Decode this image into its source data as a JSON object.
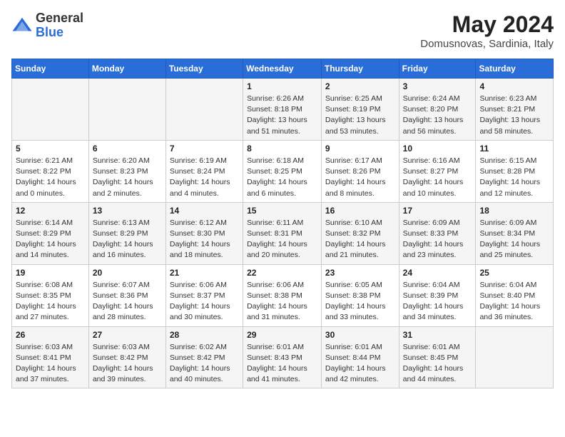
{
  "header": {
    "logo_general": "General",
    "logo_blue": "Blue",
    "title": "May 2024",
    "location": "Domusnovas, Sardinia, Italy"
  },
  "weekdays": [
    "Sunday",
    "Monday",
    "Tuesday",
    "Wednesday",
    "Thursday",
    "Friday",
    "Saturday"
  ],
  "weeks": [
    [
      {
        "day": "",
        "sunrise": "",
        "sunset": "",
        "daylight": ""
      },
      {
        "day": "",
        "sunrise": "",
        "sunset": "",
        "daylight": ""
      },
      {
        "day": "",
        "sunrise": "",
        "sunset": "",
        "daylight": ""
      },
      {
        "day": "1",
        "sunrise": "Sunrise: 6:26 AM",
        "sunset": "Sunset: 8:18 PM",
        "daylight": "Daylight: 13 hours and 51 minutes."
      },
      {
        "day": "2",
        "sunrise": "Sunrise: 6:25 AM",
        "sunset": "Sunset: 8:19 PM",
        "daylight": "Daylight: 13 hours and 53 minutes."
      },
      {
        "day": "3",
        "sunrise": "Sunrise: 6:24 AM",
        "sunset": "Sunset: 8:20 PM",
        "daylight": "Daylight: 13 hours and 56 minutes."
      },
      {
        "day": "4",
        "sunrise": "Sunrise: 6:23 AM",
        "sunset": "Sunset: 8:21 PM",
        "daylight": "Daylight: 13 hours and 58 minutes."
      }
    ],
    [
      {
        "day": "5",
        "sunrise": "Sunrise: 6:21 AM",
        "sunset": "Sunset: 8:22 PM",
        "daylight": "Daylight: 14 hours and 0 minutes."
      },
      {
        "day": "6",
        "sunrise": "Sunrise: 6:20 AM",
        "sunset": "Sunset: 8:23 PM",
        "daylight": "Daylight: 14 hours and 2 minutes."
      },
      {
        "day": "7",
        "sunrise": "Sunrise: 6:19 AM",
        "sunset": "Sunset: 8:24 PM",
        "daylight": "Daylight: 14 hours and 4 minutes."
      },
      {
        "day": "8",
        "sunrise": "Sunrise: 6:18 AM",
        "sunset": "Sunset: 8:25 PM",
        "daylight": "Daylight: 14 hours and 6 minutes."
      },
      {
        "day": "9",
        "sunrise": "Sunrise: 6:17 AM",
        "sunset": "Sunset: 8:26 PM",
        "daylight": "Daylight: 14 hours and 8 minutes."
      },
      {
        "day": "10",
        "sunrise": "Sunrise: 6:16 AM",
        "sunset": "Sunset: 8:27 PM",
        "daylight": "Daylight: 14 hours and 10 minutes."
      },
      {
        "day": "11",
        "sunrise": "Sunrise: 6:15 AM",
        "sunset": "Sunset: 8:28 PM",
        "daylight": "Daylight: 14 hours and 12 minutes."
      }
    ],
    [
      {
        "day": "12",
        "sunrise": "Sunrise: 6:14 AM",
        "sunset": "Sunset: 8:29 PM",
        "daylight": "Daylight: 14 hours and 14 minutes."
      },
      {
        "day": "13",
        "sunrise": "Sunrise: 6:13 AM",
        "sunset": "Sunset: 8:29 PM",
        "daylight": "Daylight: 14 hours and 16 minutes."
      },
      {
        "day": "14",
        "sunrise": "Sunrise: 6:12 AM",
        "sunset": "Sunset: 8:30 PM",
        "daylight": "Daylight: 14 hours and 18 minutes."
      },
      {
        "day": "15",
        "sunrise": "Sunrise: 6:11 AM",
        "sunset": "Sunset: 8:31 PM",
        "daylight": "Daylight: 14 hours and 20 minutes."
      },
      {
        "day": "16",
        "sunrise": "Sunrise: 6:10 AM",
        "sunset": "Sunset: 8:32 PM",
        "daylight": "Daylight: 14 hours and 21 minutes."
      },
      {
        "day": "17",
        "sunrise": "Sunrise: 6:09 AM",
        "sunset": "Sunset: 8:33 PM",
        "daylight": "Daylight: 14 hours and 23 minutes."
      },
      {
        "day": "18",
        "sunrise": "Sunrise: 6:09 AM",
        "sunset": "Sunset: 8:34 PM",
        "daylight": "Daylight: 14 hours and 25 minutes."
      }
    ],
    [
      {
        "day": "19",
        "sunrise": "Sunrise: 6:08 AM",
        "sunset": "Sunset: 8:35 PM",
        "daylight": "Daylight: 14 hours and 27 minutes."
      },
      {
        "day": "20",
        "sunrise": "Sunrise: 6:07 AM",
        "sunset": "Sunset: 8:36 PM",
        "daylight": "Daylight: 14 hours and 28 minutes."
      },
      {
        "day": "21",
        "sunrise": "Sunrise: 6:06 AM",
        "sunset": "Sunset: 8:37 PM",
        "daylight": "Daylight: 14 hours and 30 minutes."
      },
      {
        "day": "22",
        "sunrise": "Sunrise: 6:06 AM",
        "sunset": "Sunset: 8:38 PM",
        "daylight": "Daylight: 14 hours and 31 minutes."
      },
      {
        "day": "23",
        "sunrise": "Sunrise: 6:05 AM",
        "sunset": "Sunset: 8:38 PM",
        "daylight": "Daylight: 14 hours and 33 minutes."
      },
      {
        "day": "24",
        "sunrise": "Sunrise: 6:04 AM",
        "sunset": "Sunset: 8:39 PM",
        "daylight": "Daylight: 14 hours and 34 minutes."
      },
      {
        "day": "25",
        "sunrise": "Sunrise: 6:04 AM",
        "sunset": "Sunset: 8:40 PM",
        "daylight": "Daylight: 14 hours and 36 minutes."
      }
    ],
    [
      {
        "day": "26",
        "sunrise": "Sunrise: 6:03 AM",
        "sunset": "Sunset: 8:41 PM",
        "daylight": "Daylight: 14 hours and 37 minutes."
      },
      {
        "day": "27",
        "sunrise": "Sunrise: 6:03 AM",
        "sunset": "Sunset: 8:42 PM",
        "daylight": "Daylight: 14 hours and 39 minutes."
      },
      {
        "day": "28",
        "sunrise": "Sunrise: 6:02 AM",
        "sunset": "Sunset: 8:42 PM",
        "daylight": "Daylight: 14 hours and 40 minutes."
      },
      {
        "day": "29",
        "sunrise": "Sunrise: 6:01 AM",
        "sunset": "Sunset: 8:43 PM",
        "daylight": "Daylight: 14 hours and 41 minutes."
      },
      {
        "day": "30",
        "sunrise": "Sunrise: 6:01 AM",
        "sunset": "Sunset: 8:44 PM",
        "daylight": "Daylight: 14 hours and 42 minutes."
      },
      {
        "day": "31",
        "sunrise": "Sunrise: 6:01 AM",
        "sunset": "Sunset: 8:45 PM",
        "daylight": "Daylight: 14 hours and 44 minutes."
      },
      {
        "day": "",
        "sunrise": "",
        "sunset": "",
        "daylight": ""
      }
    ]
  ]
}
